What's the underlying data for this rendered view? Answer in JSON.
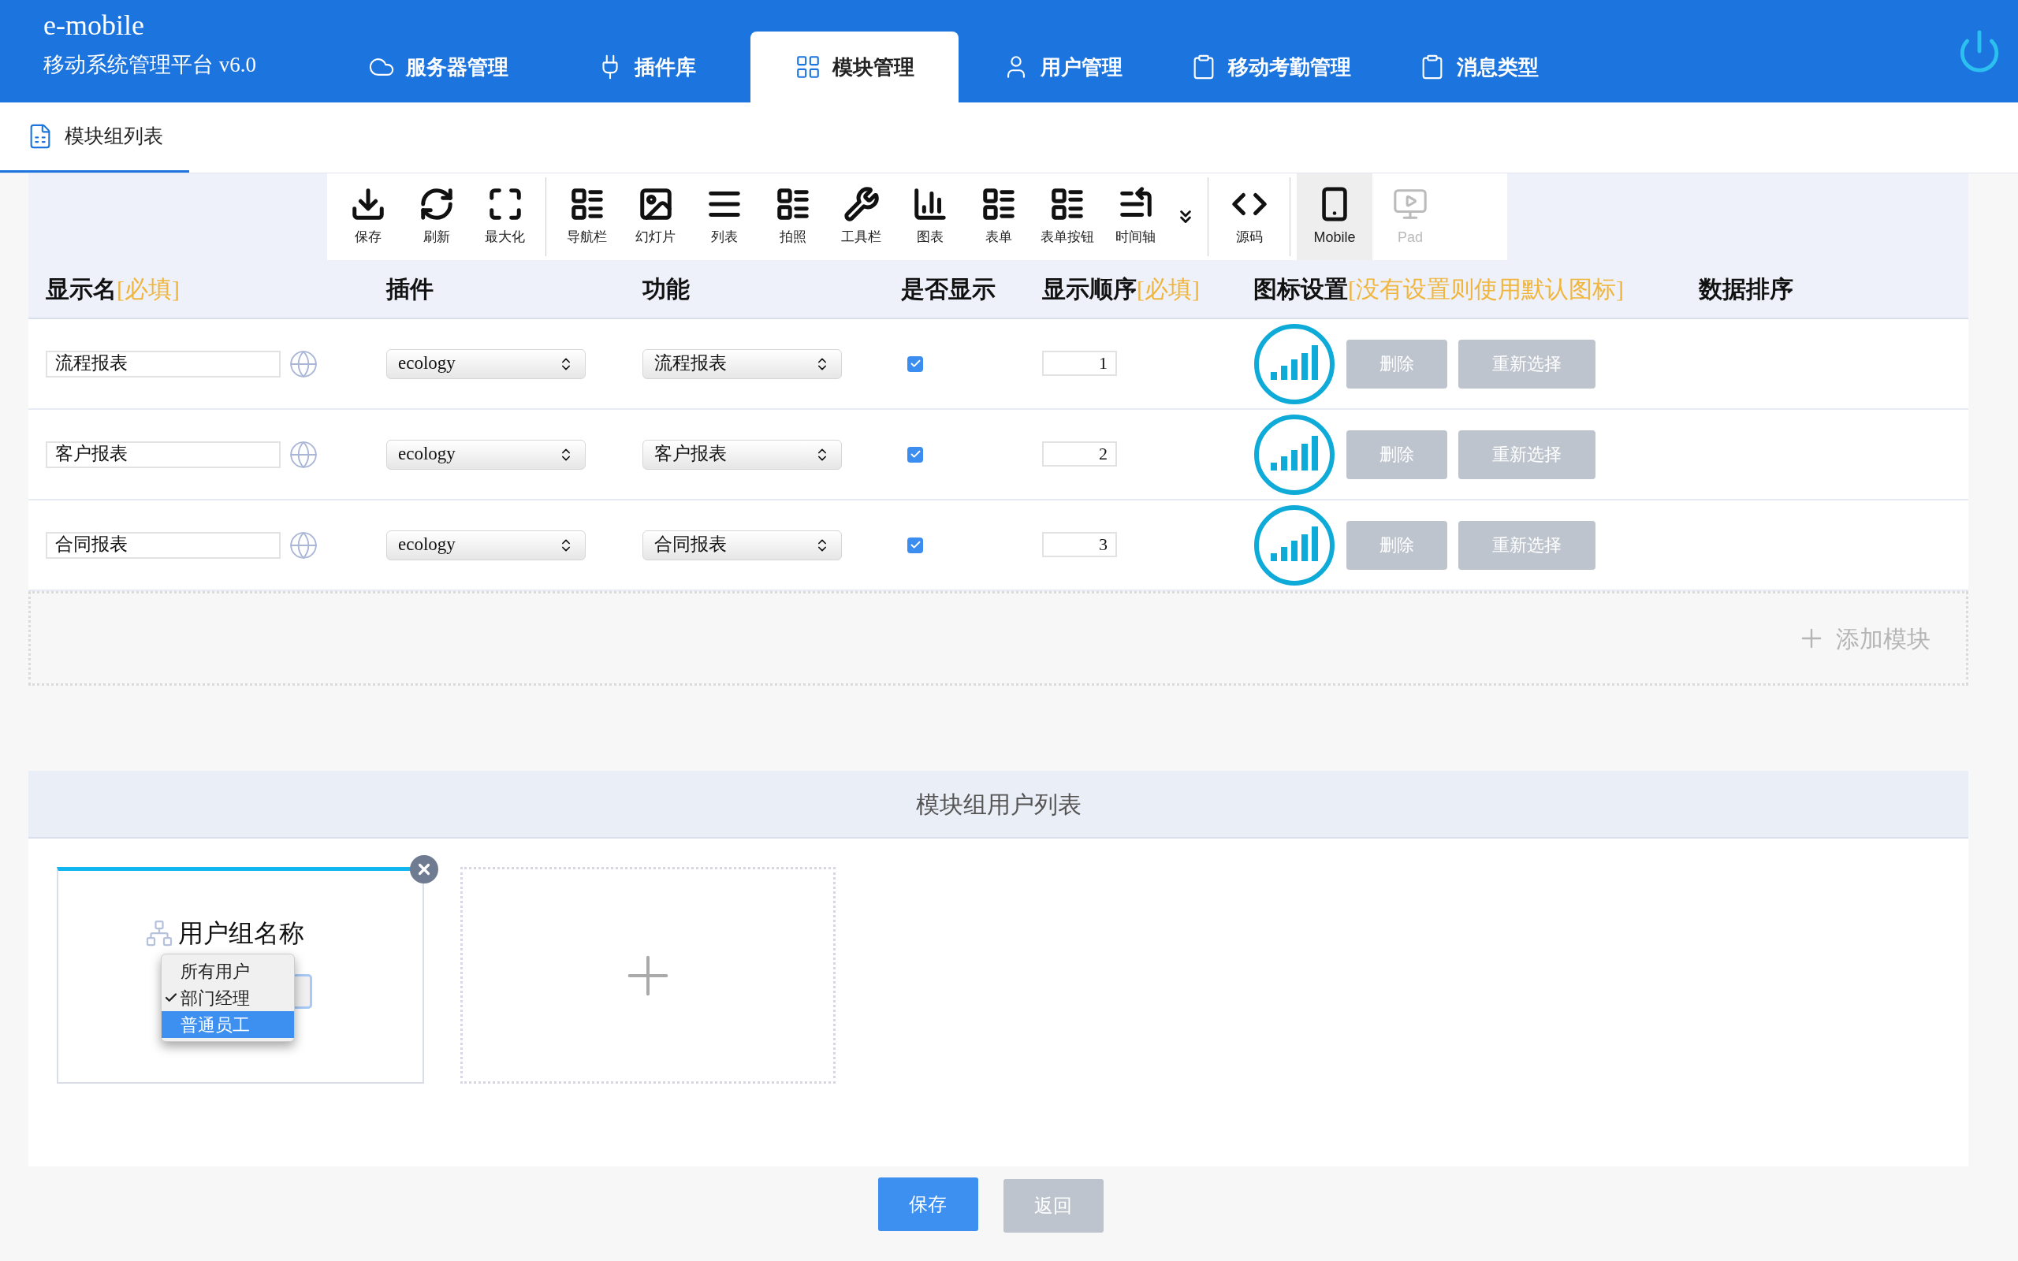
{
  "app": {
    "name": "e-mobile",
    "subtitle": "移动系统管理平台 v6.0"
  },
  "nav_tabs": [
    {
      "label": "服务器管理",
      "kind": "cloud",
      "selected": false
    },
    {
      "label": "插件库",
      "kind": "plug",
      "selected": false
    },
    {
      "label": "模块管理",
      "kind": "grid",
      "selected": true
    },
    {
      "label": "用户管理",
      "kind": "user",
      "selected": false
    },
    {
      "label": "移动考勤管理",
      "kind": "clipboard",
      "selected": false
    },
    {
      "label": "消息类型",
      "kind": "clipboard",
      "selected": false
    }
  ],
  "page_tab": {
    "label": "模块组列表",
    "selected": true
  },
  "toolbar": {
    "groups": [
      [
        {
          "label": "保存",
          "kind": "download"
        },
        {
          "label": "刷新",
          "kind": "refresh"
        },
        {
          "label": "最大化",
          "kind": "maximize"
        }
      ],
      [
        {
          "label": "导航栏",
          "kind": "list"
        },
        {
          "label": "幻灯片",
          "kind": "image"
        },
        {
          "label": "列表",
          "kind": "lines"
        },
        {
          "label": "拍照",
          "kind": "list"
        },
        {
          "label": "工具栏",
          "kind": "tools"
        },
        {
          "label": "图表",
          "kind": "chart"
        },
        {
          "label": "表单",
          "kind": "list"
        },
        {
          "label": "表单按钮",
          "kind": "list"
        },
        {
          "label": "时间轴",
          "kind": "timeline"
        },
        {
          "kind": "more"
        }
      ],
      [
        {
          "label": "源码",
          "kind": "code"
        }
      ]
    ],
    "devices": [
      {
        "label": "Mobile",
        "kind": "phone",
        "selected": true
      },
      {
        "label": "Pad",
        "kind": "tablet",
        "selected": false
      }
    ]
  },
  "table": {
    "columns": [
      {
        "label": "显示名",
        "note": "[必填]"
      },
      {
        "label": "插件"
      },
      {
        "label": "功能"
      },
      {
        "label": "是否显示"
      },
      {
        "label": "显示顺序",
        "note": "[必填]"
      },
      {
        "label": "图标设置",
        "note": "[没有设置则使用默认图标]"
      },
      {
        "label": "数据排序"
      }
    ],
    "rows": [
      {
        "name": "流程报表",
        "plugin": "ecology",
        "function": "流程报表",
        "visible": true,
        "order": "1",
        "delete": "删除",
        "reselect": "重新选择"
      },
      {
        "name": "客户报表",
        "plugin": "ecology",
        "function": "客户报表",
        "visible": true,
        "order": "2",
        "delete": "删除",
        "reselect": "重新选择"
      },
      {
        "name": "合同报表",
        "plugin": "ecology",
        "function": "合同报表",
        "visible": true,
        "order": "3",
        "delete": "删除",
        "reselect": "重新选择"
      }
    ]
  },
  "add_module": "添加模块",
  "user_section": {
    "title": "模块组用户列表",
    "groups": [
      {
        "title": "用户组名称",
        "options": [
          {
            "label": "所有用户",
            "checked": false,
            "selected": false
          },
          {
            "label": "部门经理",
            "checked": true,
            "selected": false
          },
          {
            "label": "普通员工",
            "checked": false,
            "selected": true
          }
        ]
      }
    ]
  },
  "buttons": [
    {
      "label": "保存",
      "kind": "primary"
    },
    {
      "label": "返回",
      "kind": "secondary"
    }
  ]
}
